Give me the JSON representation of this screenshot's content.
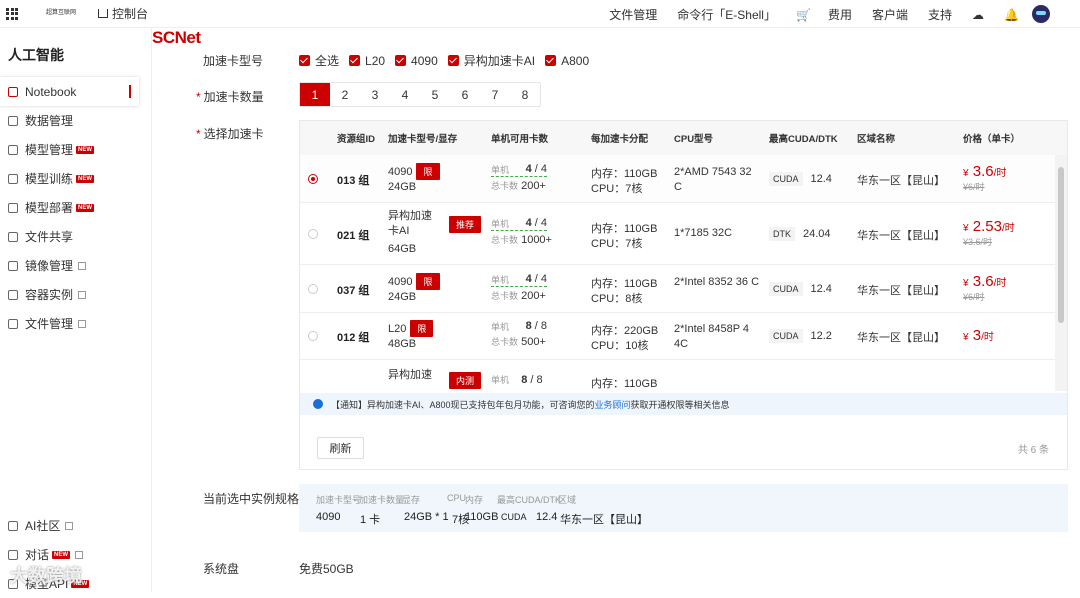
{
  "topbar": {
    "brand": "SCNet",
    "brand_sub": "超算互联网",
    "console": "控制台",
    "nav": [
      "文件管理",
      "命令行「E-Shell」",
      "费用",
      "客户端",
      "支持"
    ]
  },
  "sidebar": {
    "title": "人工智能",
    "items": [
      {
        "label": "Notebook",
        "new": false,
        "ext": false
      },
      {
        "label": "数据管理",
        "new": false,
        "ext": false
      },
      {
        "label": "模型管理",
        "new": true,
        "ext": false
      },
      {
        "label": "模型训练",
        "new": true,
        "ext": false
      },
      {
        "label": "模型部署",
        "new": true,
        "ext": false
      },
      {
        "label": "文件共享",
        "new": false,
        "ext": false
      },
      {
        "label": "镜像管理",
        "new": false,
        "ext": true
      },
      {
        "label": "容器实例",
        "new": false,
        "ext": true
      },
      {
        "label": "文件管理",
        "new": false,
        "ext": true
      }
    ],
    "bottom": [
      {
        "label": "AI社区"
      },
      {
        "label": "对话"
      },
      {
        "label": "模型API"
      }
    ],
    "new_label": "NEW"
  },
  "form": {
    "card_type_label": "加速卡型号",
    "card_types": [
      "全选",
      "L20",
      "4090",
      "异构加速卡AI",
      "A800"
    ],
    "card_count_label": "加速卡数量",
    "counts": [
      "1",
      "2",
      "3",
      "4",
      "5",
      "6",
      "7",
      "8"
    ],
    "selected_count": "1",
    "select_card_label": "选择加速卡",
    "current_spec_label": "当前选中实例规格",
    "system_disk_label": "系统盘",
    "system_disk_value": "免费50GB"
  },
  "table": {
    "headers": [
      "资源组ID",
      "加速卡型号/显存",
      "单机可用卡数",
      "每加速卡分配",
      "CPU型号",
      "最高CUDA/DTK",
      "区域名称",
      "价格（单卡）"
    ],
    "rows": [
      {
        "id": "013 组",
        "model": "4090",
        "vram": "24GB",
        "tag": "限",
        "single": "4",
        "single_total": "4",
        "total": "200+",
        "mem": "内存：110GB",
        "cpu": "CPU：7核",
        "cpu_model": "2*AMD 7543 32 C",
        "drv": "CUDA",
        "drv_ver": "12.4",
        "region": "华东一区【昆山】",
        "price": "3.6",
        "old_price": "¥6/时",
        "selected": true
      },
      {
        "id": "021 组",
        "model": "异构加速卡AI",
        "vram": "64GB",
        "tag": "推荐",
        "single": "4",
        "single_total": "4",
        "total": "1000+",
        "mem": "内存：110GB",
        "cpu": "CPU：7核",
        "cpu_model": "1*7185 32C",
        "drv": "DTK",
        "drv_ver": "24.04",
        "region": "华东一区【昆山】",
        "price": "2.53",
        "old_price": "¥3.6/时",
        "selected": false
      },
      {
        "id": "037 组",
        "model": "4090",
        "vram": "24GB",
        "tag": "限",
        "single": "4",
        "single_total": "4",
        "total": "200+",
        "mem": "内存：110GB",
        "cpu": "CPU：8核",
        "cpu_model": "2*Intel 8352 36 C",
        "drv": "CUDA",
        "drv_ver": "12.4",
        "region": "华东一区【昆山】",
        "price": "3.6",
        "old_price": "¥6/时",
        "selected": false
      },
      {
        "id": "012 组",
        "model": "L20",
        "vram": "48GB",
        "tag": "限",
        "single": "8",
        "single_total": "8",
        "total": "500+",
        "mem": "内存：220GB",
        "cpu": "CPU：10核",
        "cpu_model": "2*Intel 8458P 4 4C",
        "drv": "CUDA",
        "drv_ver": "12.2",
        "region": "华东一区【昆山】",
        "price": "3",
        "old_price": "",
        "selected": false
      }
    ],
    "partial_row": {
      "model": "异构加速",
      "tag": "内测",
      "single": "8",
      "single_total": "8",
      "mem": "内存：110GB"
    },
    "single_label": "单机",
    "total_label": "总卡数",
    "currency": "¥",
    "unit": "/时",
    "notice_prefix": "【通知】异构加速卡AI、A800现已支持包年包月功能，可咨询您的",
    "notice_link": "业务顾问",
    "notice_suffix": "获取开通权限等相关信息",
    "refresh": "刷新",
    "total_count": "共 6 条"
  },
  "spec": {
    "headers": [
      "加速卡型号",
      "加速卡数量",
      "显存",
      "CPU",
      "内存",
      "最高CUDA/DTK",
      "区域"
    ],
    "values": [
      "4090",
      "1 卡",
      "24GB * 1",
      "7核",
      "110GB",
      "CUDA",
      "12.4",
      "华东一区【昆山】"
    ]
  },
  "watermark": "大数跨境"
}
